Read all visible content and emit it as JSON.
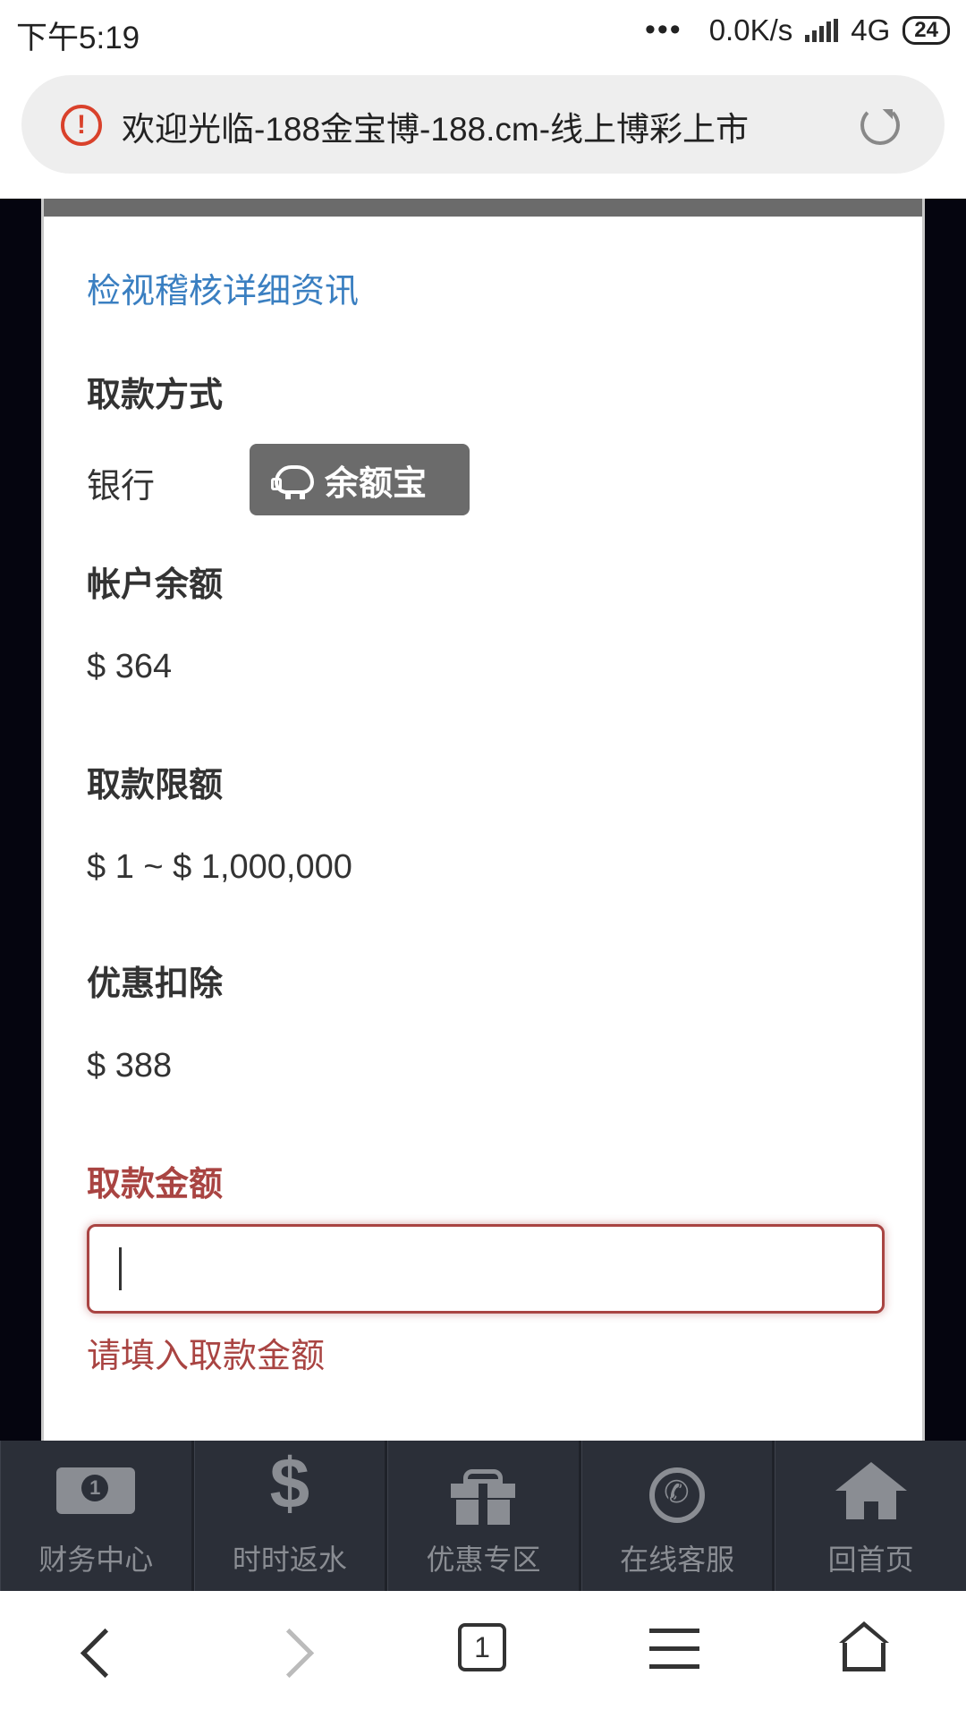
{
  "status_bar": {
    "time": "下午5:19",
    "dots": "•••",
    "network_speed": "0.0K/s",
    "network_type": "4G",
    "battery": "24"
  },
  "address_bar": {
    "title": "欢迎光临-188金宝博-188.cm-线上博彩上市"
  },
  "content": {
    "audit_link": "检视稽核详细资讯",
    "withdraw_method_label": "取款方式",
    "withdraw_method_value": "银行",
    "balance_treasure_button": "余额宝",
    "account_balance_label": "帐户余额",
    "account_balance_value": "$ 364",
    "withdraw_limit_label": "取款限额",
    "withdraw_limit_value": "$ 1 ~ $ 1,000,000",
    "promo_deduction_label": "优惠扣除",
    "promo_deduction_value": "$ 388",
    "withdraw_amount_label": "取款金额",
    "withdraw_amount_value": "",
    "withdraw_amount_error": "请填入取款金额"
  },
  "site_nav": {
    "items": [
      {
        "label": "财务中心",
        "icon": "money-bill-icon"
      },
      {
        "label": "时时返水",
        "icon": "dollar-icon"
      },
      {
        "label": "优惠专区",
        "icon": "gift-icon"
      },
      {
        "label": "在线客服",
        "icon": "whatsapp-icon"
      },
      {
        "label": "回首页",
        "icon": "home-icon"
      }
    ]
  },
  "browser_toolbar": {
    "tab_count": "1"
  },
  "colors": {
    "link": "#3a7fc1",
    "error": "#a94442",
    "button_gray": "#6b6b6b",
    "nav_bg": "#2b2f38"
  }
}
